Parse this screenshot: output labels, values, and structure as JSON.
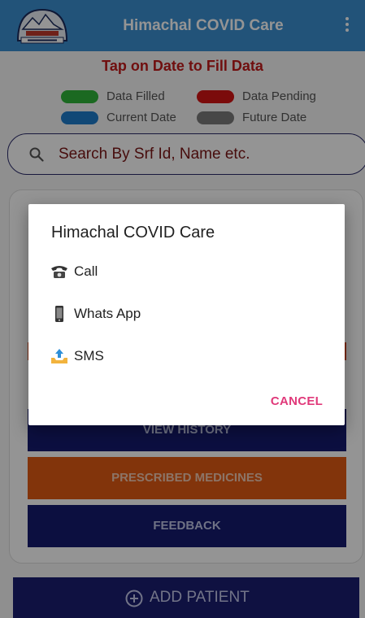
{
  "appbar": {
    "title": "Himachal COVID Care",
    "logo_icon": "himachal-emblem-icon",
    "menu_icon": "kebab-menu-icon",
    "color": "#3b8fd1"
  },
  "main": {
    "hint": "Tap on Date to Fill Data",
    "legend": [
      {
        "label": "Data Filled",
        "color": "#2fb53a"
      },
      {
        "label": "Data Pending",
        "color": "#d51313"
      },
      {
        "label": "Current Date",
        "color": "#1e7ccc"
      },
      {
        "label": "Future Date",
        "color": "#7b7b7b"
      }
    ],
    "search": {
      "placeholder": "Search By Srf Id, Name etc.",
      "icon": "search-icon"
    },
    "buttons": {
      "view_history": "VIEW HISTORY",
      "prescribed_medicines": "PRESCRIBED MEDICINES",
      "feedback": "FEEDBACK"
    },
    "add_patient": {
      "label": "ADD PATIENT",
      "icon": "plus-circle-icon"
    }
  },
  "dialog": {
    "title": "Himachal COVID Care",
    "items": [
      {
        "label": "Call",
        "icon": "telephone-icon"
      },
      {
        "label": "Whats App",
        "icon": "mobile-phone-icon"
      },
      {
        "label": "SMS",
        "icon": "outbox-tray-icon"
      }
    ],
    "cancel": "CANCEL",
    "accent": "#e0397a"
  }
}
